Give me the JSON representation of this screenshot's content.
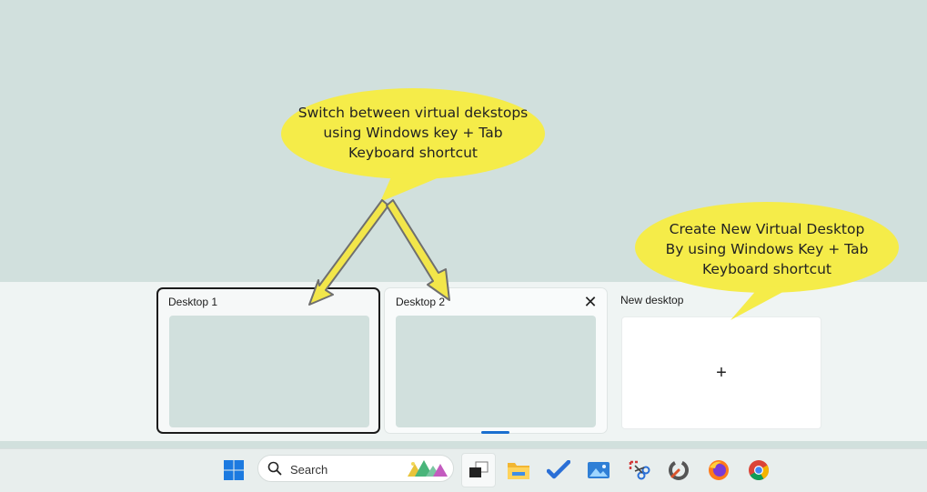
{
  "task_view": {
    "desktops": [
      {
        "label": "Desktop 1",
        "selected": true
      },
      {
        "label": "Desktop 2",
        "selected": false,
        "close_glyph": "✕"
      }
    ],
    "new_desktop": {
      "label": "New desktop",
      "glyph": "+"
    }
  },
  "callouts": {
    "switch": [
      "Switch between virtual dekstops",
      "using Windows key + Tab",
      "Keyboard shortcut"
    ],
    "create": [
      "Create New Virtual Desktop",
      "By using Windows Key + Tab",
      "Keyboard shortcut"
    ]
  },
  "taskbar": {
    "search_placeholder": "Search",
    "icons": [
      "windows-start-icon",
      "task-view-icon",
      "file-explorer-icon",
      "todo-icon",
      "photos-icon",
      "snipping-tool-icon",
      "ccleaner-icon",
      "firefox-icon",
      "chrome-icon"
    ]
  },
  "colors": {
    "wallpaper": "#d1e0dd",
    "callout": "#f5ec49",
    "arrow": "#f2e64a",
    "accent": "#1a6fcf"
  }
}
